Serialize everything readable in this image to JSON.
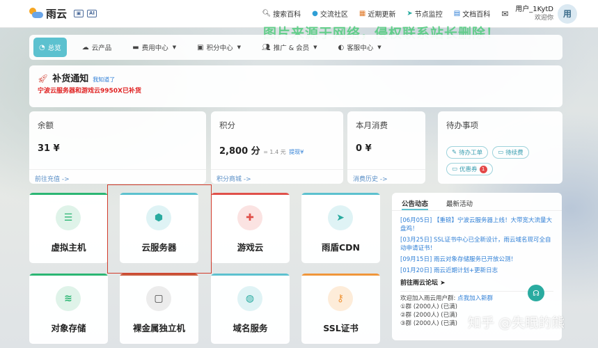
{
  "header": {
    "brand": "雨云",
    "nav": [
      {
        "icon": "search-icon",
        "label": "搜索百科"
      },
      {
        "icon": "forum-icon",
        "label": "交流社区"
      },
      {
        "icon": "calendar-icon",
        "label": "近期更新"
      },
      {
        "icon": "location-icon",
        "label": "节点监控"
      },
      {
        "icon": "book-icon",
        "label": "文档百科"
      }
    ],
    "user_name": "用户_1KytD",
    "user_welcome": "欢迎你",
    "avatar_text": "用"
  },
  "watermark": "图片来源于网络，侵权联系站长删除！",
  "tabs": [
    {
      "label": "总览",
      "icon": "dashboard-icon",
      "active": true
    },
    {
      "label": "云产品",
      "icon": "cloud-products-icon"
    },
    {
      "label": "费用中心",
      "icon": "billing-icon",
      "dropdown": true
    },
    {
      "label": "积分中心",
      "icon": "gift-icon",
      "dropdown": true
    },
    {
      "label": "推广 & 会员",
      "icon": "users-icon",
      "dropdown": true
    },
    {
      "label": "客服中心",
      "icon": "headset-icon",
      "dropdown": true
    }
  ],
  "notice": {
    "title": "补货通知",
    "known": "我知道了",
    "body": "宁波云服务器和游戏云9950X已补货"
  },
  "stats": {
    "balance": {
      "label": "余额",
      "value": "31 ¥",
      "link": "前往充值 ->"
    },
    "points": {
      "label": "积分",
      "value": "2,800 分",
      "rate": "= 1.4 元",
      "withdraw": "提现¥",
      "link": "积分商城 ->"
    },
    "monthly": {
      "label": "本月消费",
      "value": "0 ¥",
      "link": "消费历史 ->"
    },
    "todo": {
      "label": "待办事项",
      "tags": [
        {
          "label": "待办工单"
        },
        {
          "label": "待续费"
        },
        {
          "label": "优惠券",
          "count": "1"
        }
      ]
    }
  },
  "services": [
    {
      "name": "虚拟主机",
      "icon": "server-icon",
      "color": "#2bb673"
    },
    {
      "name": "云服务器",
      "icon": "cube-icon",
      "color": "#5cc1cf"
    },
    {
      "name": "游戏云",
      "icon": "gamepad-icon",
      "color": "#e0504a"
    },
    {
      "name": "雨盾CDN",
      "icon": "send-icon",
      "color": "#5cc1cf"
    },
    {
      "name": "对象存储",
      "icon": "database-icon",
      "color": "#2bb673"
    },
    {
      "name": "裸金属独立机",
      "icon": "chip-icon",
      "color": "#c9573a"
    },
    {
      "name": "域名服务",
      "icon": "globe-icon",
      "color": "#5cc1cf"
    },
    {
      "name": "SSL证书",
      "icon": "key-icon",
      "color": "#f0963a"
    }
  ],
  "announcements": {
    "tabs": [
      "公告动态",
      "最新活动"
    ],
    "items": [
      "[06月05日] 【重磅】宁波云服务器上线！大带宽大流量大盘鸡！",
      "[03月25日] SSL证书中心已全新设计，雨云域名现可全自动申请证书！",
      "[09月15日] 雨云对象存储服务已开放公测！",
      "[01月20日] 雨云近期计划+更新日志"
    ],
    "forum": "前往雨云论坛",
    "group_intro": "欢迎加入雨云用户群:",
    "group_link": "点我加入新群",
    "groups": [
      "①群 (2000人) (已满)",
      "②群 (2000人) (已满)",
      "③群 (2000人) (已满)"
    ]
  },
  "overlay_text": "知乎 @失眠的熊"
}
